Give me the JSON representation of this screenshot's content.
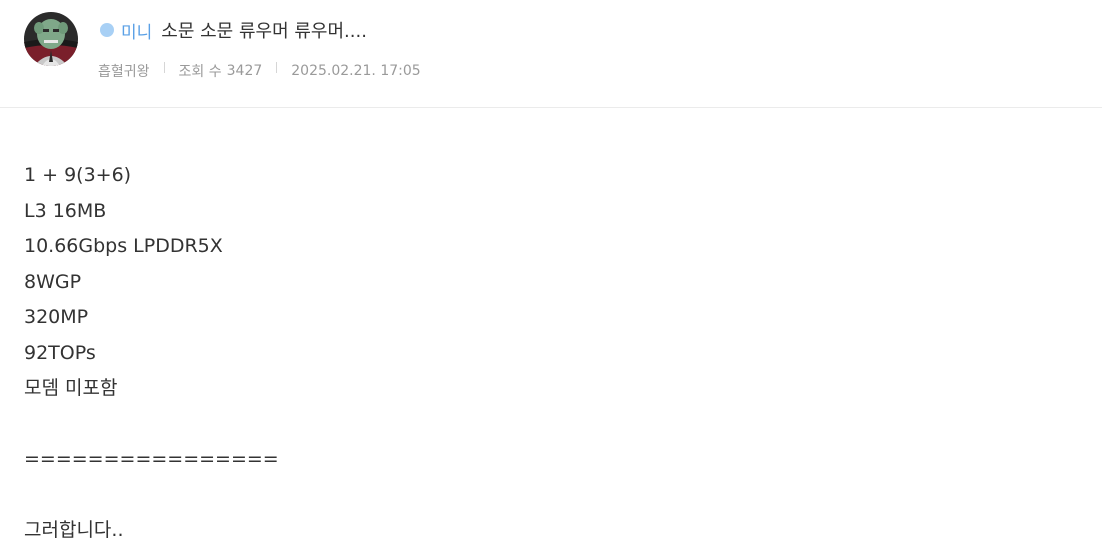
{
  "post": {
    "category": "미니",
    "title": "소문 소문 류우머 류우머....",
    "author": "흡혈귀왕",
    "views_label": "조회 수",
    "views": "3427",
    "datetime": "2025.02.21. 17:05"
  },
  "colors": {
    "category_dot": "#a8d0f5",
    "category_text": "#5aa0e6",
    "meta_text": "#9a9a9a",
    "body_text": "#333333"
  },
  "body_lines": [
    "1 + 9(3+6)",
    "L3 16MB",
    "10.66Gbps LPDDR5X",
    "8WGP",
    "320MP",
    "92TOPs",
    "모뎀 미포함",
    "",
    "================",
    "",
    "그러합니다.."
  ]
}
